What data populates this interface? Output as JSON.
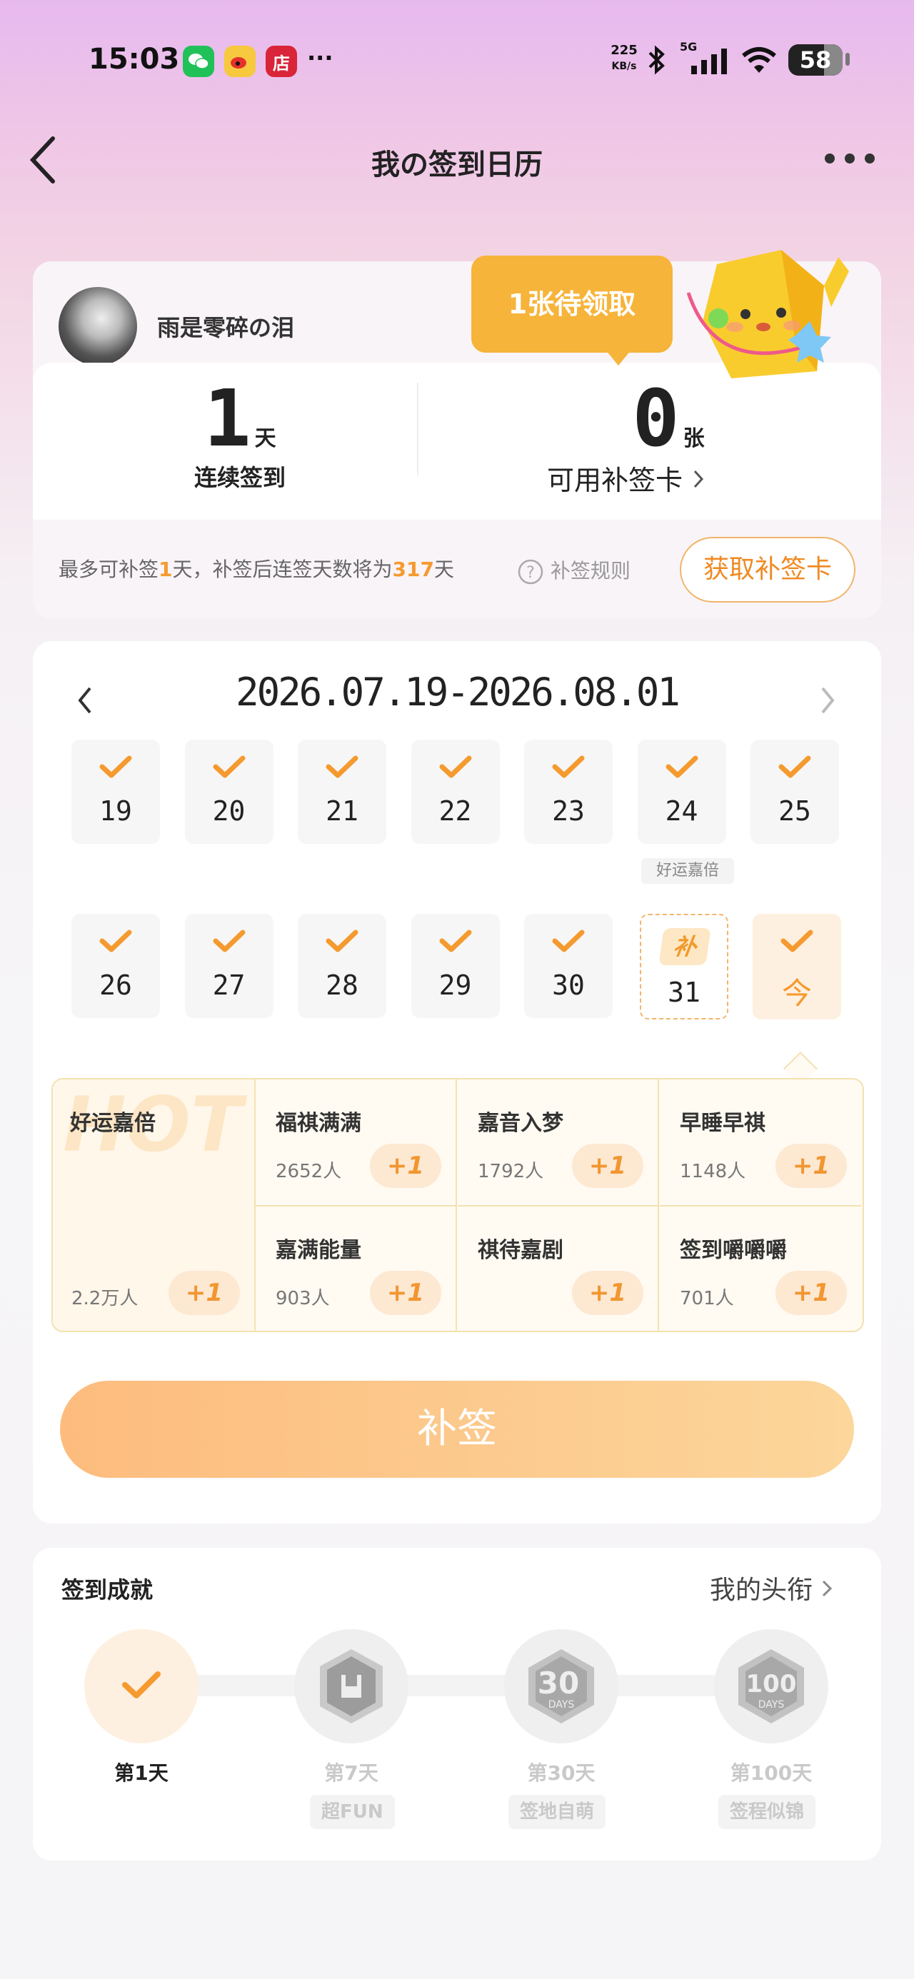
{
  "status_bar": {
    "time": "15:03",
    "speed_value": "225",
    "speed_unit": "KB/s",
    "network": "5G",
    "battery": "58",
    "store_icon_text": "店",
    "more": "···"
  },
  "nav": {
    "title": "我の签到日历"
  },
  "profile": {
    "username": "雨是零碎の泪",
    "tooltip": "1张待领取"
  },
  "stats": {
    "streak_value": "1",
    "streak_unit": "天",
    "streak_label": "连续签到",
    "cards_value": "0",
    "cards_unit": "张",
    "cards_label": "可用补签卡"
  },
  "makeup_info": {
    "text_prefix": "最多可补签",
    "days": "1",
    "text_mid1": "天，补签后连签天数将为",
    "streak_after": "317",
    "text_suffix": "天",
    "rules_link": "补签规则",
    "get_card_button": "获取补签卡"
  },
  "calendar": {
    "range": "2026.07.19-2026.08.01",
    "week1": [
      {
        "label": "19"
      },
      {
        "label": "20"
      },
      {
        "label": "21"
      },
      {
        "label": "22"
      },
      {
        "label": "23"
      },
      {
        "label": "24"
      },
      {
        "label": "25"
      }
    ],
    "week1_note": "好运嘉倍",
    "week2": [
      {
        "label": "26"
      },
      {
        "label": "27"
      },
      {
        "label": "28"
      },
      {
        "label": "29"
      },
      {
        "label": "30"
      }
    ],
    "makeup_day": {
      "badge": "补",
      "label": "31"
    },
    "today": {
      "label": "今"
    }
  },
  "categories": {
    "featured": {
      "title": "好运嘉倍",
      "watermark": "HOT",
      "count": "2.2万人",
      "plus": "+1"
    },
    "items": [
      {
        "title": "福祺满满",
        "count": "2652人",
        "plus": "+1"
      },
      {
        "title": "嘉音入梦",
        "count": "1792人",
        "plus": "+1"
      },
      {
        "title": "早睡早祺",
        "count": "1148人",
        "plus": "+1"
      },
      {
        "title": "嘉满能量",
        "count": "903人",
        "plus": "+1"
      },
      {
        "title": "祺待嘉剧",
        "count": "",
        "plus": "+1"
      },
      {
        "title": "签到嚼嚼嚼",
        "count": "701人",
        "plus": "+1"
      }
    ]
  },
  "makeup_button": "补签",
  "achievements": {
    "title": "签到成就",
    "link": "我的头衔",
    "items": [
      {
        "label": "第1天",
        "badge": ""
      },
      {
        "label": "第7天",
        "badge": "超FUN"
      },
      {
        "label": "第30天",
        "badge": "签地自萌",
        "icon_text": "30"
      },
      {
        "label": "第100天",
        "badge": "签程似锦",
        "icon_text": "100"
      }
    ],
    "days_text": "DAYS"
  },
  "colors": {
    "accent": "#f59a2f",
    "button_start": "#fdbc7e",
    "button_end": "#fcd69b",
    "tooltip": "#f6b43a"
  }
}
